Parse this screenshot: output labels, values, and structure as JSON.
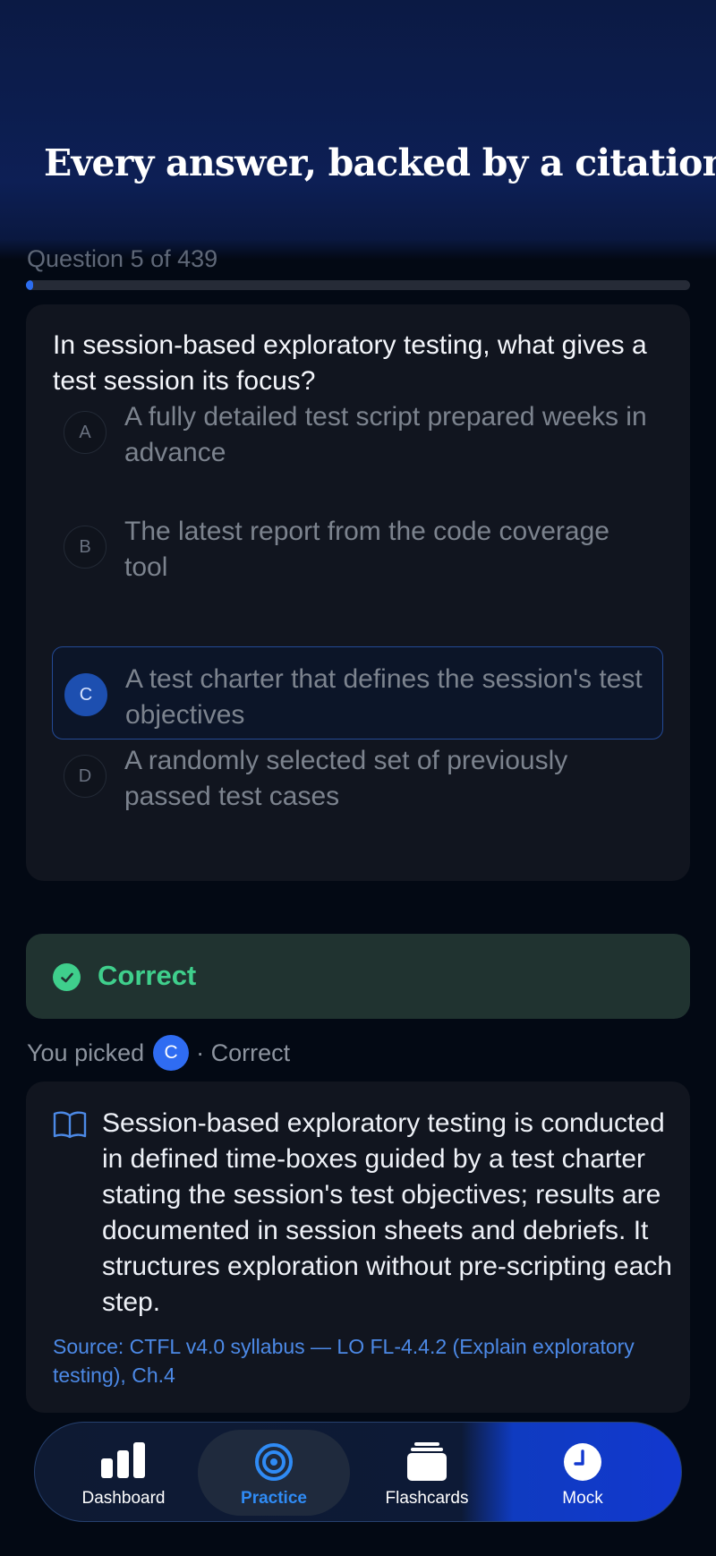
{
  "hero": {
    "title": "Every answer, backed by a citation."
  },
  "quiz": {
    "counter": "Question 5 of 439",
    "progress": 0.011,
    "question": "In session-based exploratory testing, what gives a test session its focus?",
    "options": [
      {
        "letter": "A",
        "text": "A fully detailed test script prepared weeks in advance"
      },
      {
        "letter": "B",
        "text": "The latest report from the code coverage tool"
      },
      {
        "letter": "C",
        "text": "A test charter that defines the session's test objectives"
      },
      {
        "letter": "D",
        "text": "A randomly selected set of previously passed test cases"
      }
    ],
    "selected": "C"
  },
  "result": {
    "status": "Correct",
    "picked_prefix": "You picked",
    "picked_letter": "C",
    "picked_suffix": "· Correct"
  },
  "explanation": {
    "text": "Session-based exploratory testing is conducted in defined time-boxes guided by a test charter stating the session's test objectives; results are documented in session sheets and debriefs. It structures exploration without pre-scripting each step.",
    "source": "Source: CTFL v4.0 syllabus — LO FL-4.4.2 (Explain exploratory testing), Ch.4"
  },
  "nav": {
    "items": [
      {
        "label": "Dashboard",
        "icon": "bar-chart-icon"
      },
      {
        "label": "Practice",
        "icon": "target-icon"
      },
      {
        "label": "Flashcards",
        "icon": "cards-icon"
      },
      {
        "label": "Mock",
        "icon": "clock-icon"
      }
    ],
    "active": "Practice"
  },
  "colors": {
    "accent": "#2f6cf2",
    "success": "#3fcf8c",
    "link": "#4c89e6",
    "background": "#030914"
  }
}
